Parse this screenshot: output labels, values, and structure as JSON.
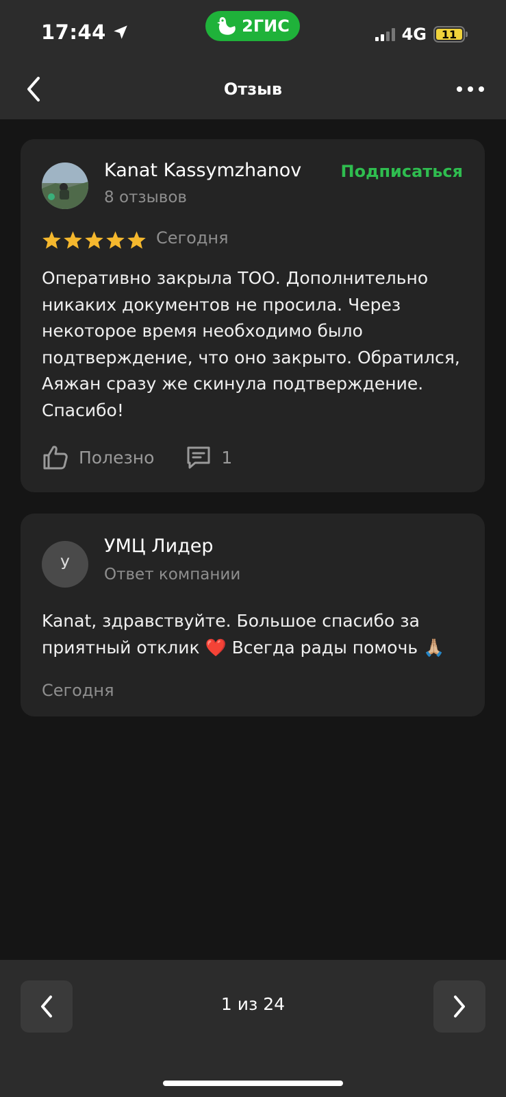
{
  "status_bar": {
    "time": "17:44",
    "app_badge": "2ГИС",
    "network": "4G",
    "battery": "11"
  },
  "nav": {
    "title": "Отзыв"
  },
  "review": {
    "author": "Kanat Kassymzhanov",
    "review_count": "8 отзывов",
    "subscribe_label": "Подписаться",
    "rating": 5,
    "date": "Сегодня",
    "text": "Оперативно закрыла ТОО. Дополнительно никаких документов не просила. Через некоторое время необходимо было подтверждение, что оно закрыто. Обратился, Аяжан сразу же скинула подтверждение. Спасибо!",
    "useful_label": "Полезно",
    "comment_count": "1"
  },
  "reply": {
    "avatar_letter": "У",
    "company": "УМЦ Лидер",
    "subtitle": "Ответ компании",
    "text": "Kanat, здравствуйте. Большое спасибо за приятный отклик ❤️ Всегда рады помочь 🙏🏼",
    "date": "Сегодня"
  },
  "pager": {
    "text": "1 из 24"
  },
  "colors": {
    "accent_green": "#2fbd4f",
    "star": "#f5b82e",
    "card_bg": "#242424",
    "page_bg": "#151515"
  }
}
